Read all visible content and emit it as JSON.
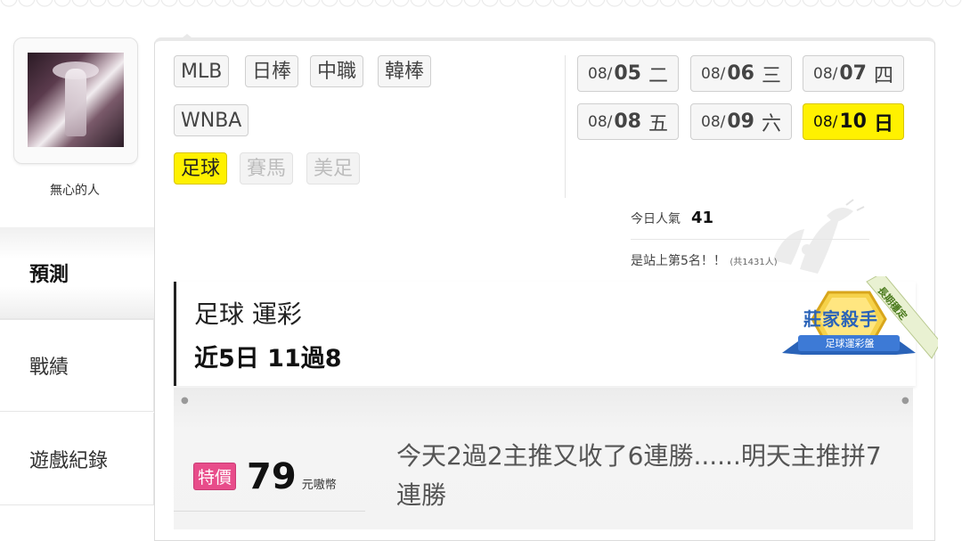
{
  "user": {
    "name": "無心的人"
  },
  "nav": [
    {
      "label": "預測",
      "active": true
    },
    {
      "label": "戰績",
      "active": false
    },
    {
      "label": "遊戲紀錄",
      "active": false
    }
  ],
  "leagues": [
    {
      "label": "MLB",
      "state": "normal"
    },
    {
      "label": "日棒",
      "state": "normal"
    },
    {
      "label": "中職",
      "state": "normal"
    },
    {
      "label": "韓棒",
      "state": "normal"
    },
    {
      "label": "WNBA",
      "state": "normal"
    },
    {
      "label": "足球",
      "state": "active"
    },
    {
      "label": "賽馬",
      "state": "disabled"
    },
    {
      "label": "美足",
      "state": "disabled"
    }
  ],
  "dates": [
    {
      "month": "08/",
      "day": "05",
      "weekday": "二",
      "active": false
    },
    {
      "month": "08/",
      "day": "06",
      "weekday": "三",
      "active": false
    },
    {
      "month": "08/",
      "day": "07",
      "weekday": "四",
      "active": false
    },
    {
      "month": "08/",
      "day": "08",
      "weekday": "五",
      "active": false
    },
    {
      "month": "08/",
      "day": "09",
      "weekday": "六",
      "active": false
    },
    {
      "month": "08/",
      "day": "10",
      "weekday": "日",
      "active": true
    }
  ],
  "popularity": {
    "label": "今日人氣",
    "value": "41",
    "rank_text": "是站上第5名！！",
    "total_text": "(共1431人)"
  },
  "stat": {
    "title": "足球 運彩",
    "record": "近5日 11過8"
  },
  "badge": {
    "main": "莊家殺手",
    "sub": "足球運彩盤",
    "ribbon": "長期穩定"
  },
  "promo": {
    "special_label": "特價",
    "price": "79",
    "unit": "元嗷幣",
    "text": "今天2過2主推又收了6連勝......明天主推拼7連勝"
  },
  "colors": {
    "active_yellow": "#fff100",
    "special_pink": "#e84c8a",
    "badge_gold": "#f2c230",
    "badge_blue": "#2a63b8"
  }
}
